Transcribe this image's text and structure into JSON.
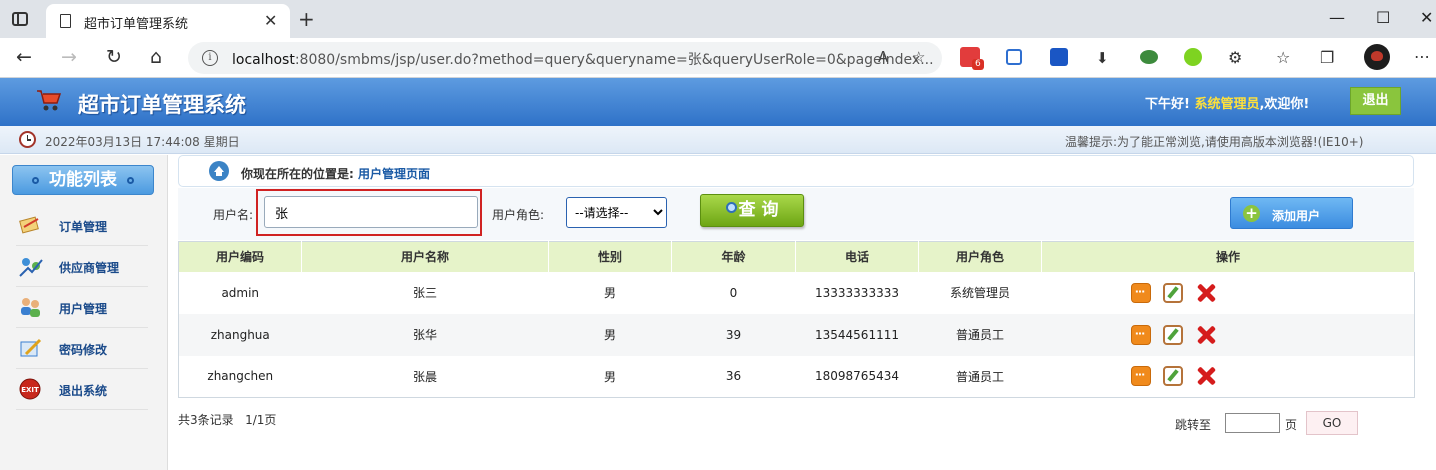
{
  "browser": {
    "tab_title": "超市订单管理系统",
    "url_host": "localhost",
    "url_rest": ":8080/smbms/jsp/user.do?method=query&queryname=张&queryUserRole=0&pageIndex...",
    "ext_badge": "6"
  },
  "header": {
    "title": "超市订单管理系统",
    "greeting_prefix": "下午好!",
    "role": "系统管理员",
    "greeting_suffix": ",欢迎你!",
    "logout": "退出"
  },
  "subheader": {
    "datetime": "2022年03月13日 17:44:08 星期日",
    "tip": "温馨提示:为了能正常浏览,请使用高版本浏览器!(IE10+)"
  },
  "sidebar": {
    "title": "功能列表",
    "items": [
      {
        "label": "订单管理",
        "icon": "order-icon"
      },
      {
        "label": "供应商管理",
        "icon": "provider-icon"
      },
      {
        "label": "用户管理",
        "icon": "users-icon"
      },
      {
        "label": "密码修改",
        "icon": "password-icon"
      },
      {
        "label": "退出系统",
        "icon": "exit-icon"
      }
    ]
  },
  "breadcrumb": {
    "prefix": "你现在所在的位置是:",
    "current": "用户管理页面"
  },
  "search": {
    "name_label": "用户名:",
    "name_value": "张",
    "role_label": "用户角色:",
    "role_selected": "--请选择--",
    "query_button": "查 询",
    "add_button": "添加用户"
  },
  "table": {
    "headers": [
      "用户编码",
      "用户名称",
      "性别",
      "年龄",
      "电话",
      "用户角色",
      "操作"
    ],
    "rows": [
      {
        "code": "admin",
        "name": "张三",
        "gender": "男",
        "age": "0",
        "phone": "13333333333",
        "role": "系统管理员"
      },
      {
        "code": "zhanghua",
        "name": "张华",
        "gender": "男",
        "age": "39",
        "phone": "13544561111",
        "role": "普通员工"
      },
      {
        "code": "zhangchen",
        "name": "张晨",
        "gender": "男",
        "age": "36",
        "phone": "18098765434",
        "role": "普通员工"
      }
    ]
  },
  "pagination": {
    "records": "共3条记录   1/1页",
    "jump_label": "跳转至",
    "page_unit": "页",
    "go": "GO"
  },
  "colors": {
    "header_blue": "#3a7fd0",
    "table_header": "#e6f3c9",
    "query_green": "#8ac53d",
    "focus_red": "#d02222"
  }
}
